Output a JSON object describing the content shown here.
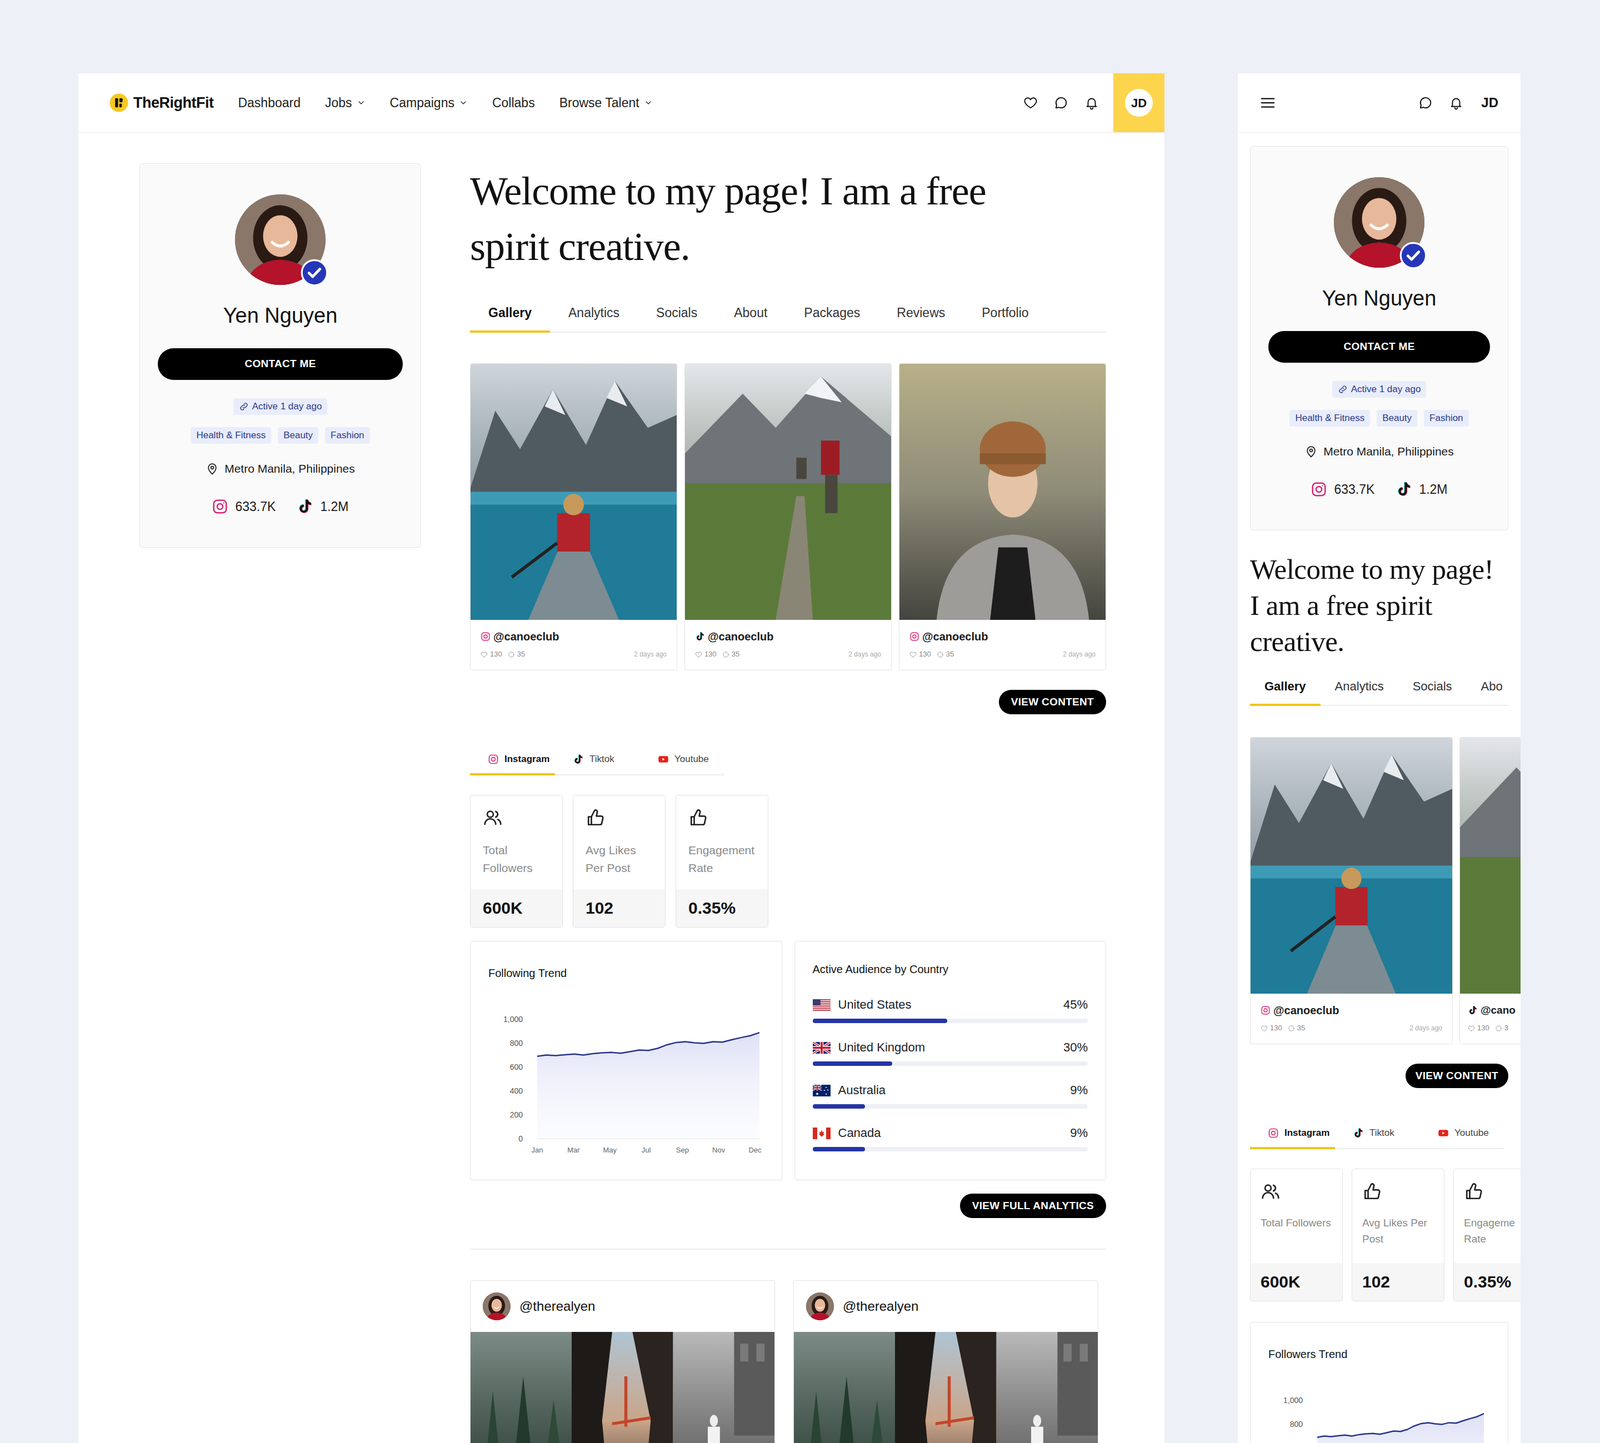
{
  "brand": {
    "name": "TheRightFit"
  },
  "nav": [
    {
      "label": "Dashboard",
      "dropdown": false
    },
    {
      "label": "Jobs",
      "dropdown": true
    },
    {
      "label": "Campaigns",
      "dropdown": true
    },
    {
      "label": "Collabs",
      "dropdown": false
    },
    {
      "label": "Browse Talent",
      "dropdown": true
    }
  ],
  "user": {
    "initials": "JD"
  },
  "profile": {
    "name": "Yen Nguyen",
    "verified": true,
    "contact_button": "CONTACT ME",
    "active": "Active 1 day ago",
    "tags": [
      "Health & Fitness",
      "Beauty",
      "Fashion"
    ],
    "location": "Metro Manila, Philippines",
    "followers": [
      {
        "platform": "instagram",
        "count": "633.7K"
      },
      {
        "platform": "tiktok",
        "count": "1.2M"
      }
    ]
  },
  "headline": "Welcome to my page! I am a free spirit creative.",
  "tabs": [
    {
      "label": "Gallery",
      "selected": true
    },
    {
      "label": "Analytics",
      "selected": false
    },
    {
      "label": "Socials",
      "selected": false
    },
    {
      "label": "About",
      "selected": false
    },
    {
      "label": "Packages",
      "selected": false
    },
    {
      "label": "Reviews",
      "selected": false
    },
    {
      "label": "Portfolio",
      "selected": false
    }
  ],
  "gallery": [
    {
      "platform": "instagram",
      "handle": "@canoeclub",
      "likes": "130",
      "comments": "35",
      "time": "2 days ago"
    },
    {
      "platform": "tiktok",
      "handle": "@canoeclub",
      "likes": "130",
      "comments": "35",
      "time": "2 days ago"
    },
    {
      "platform": "instagram",
      "handle": "@canoeclub",
      "likes": "130",
      "comments": "35",
      "time": "2 days ago"
    }
  ],
  "view_content": "VIEW CONTENT",
  "platform_tabs": [
    {
      "platform": "instagram",
      "label": "Instagram",
      "selected": true
    },
    {
      "platform": "tiktok",
      "label": "Tiktok",
      "selected": false
    },
    {
      "platform": "youtube",
      "label": "Youtube",
      "selected": false
    }
  ],
  "metrics": [
    {
      "kind": "followers",
      "label": "Total Followers",
      "value": "600K"
    },
    {
      "kind": "likes",
      "label": "Avg Likes Per Post",
      "value": "102"
    },
    {
      "kind": "likes",
      "label": "Engagement Rate",
      "value": "0.35%"
    }
  ],
  "trend": {
    "title": "Following Trend",
    "y_ticks": [
      "1,000",
      "800",
      "600",
      "400",
      "200",
      "0"
    ],
    "x_ticks": [
      "Jan",
      "Mar",
      "May",
      "Jul",
      "Sep",
      "Nov",
      "Dec"
    ],
    "values": [
      690,
      700,
      696,
      702,
      708,
      700,
      712,
      718,
      722,
      715,
      728,
      742,
      738,
      756,
      785,
      805,
      812,
      802,
      798,
      812,
      808,
      828,
      846,
      862,
      888
    ]
  },
  "audience": {
    "title": "Active Audience by Country",
    "rows": [
      {
        "flag": "us",
        "country": "United States",
        "share": "45%",
        "level": 0.49
      },
      {
        "flag": "uk",
        "country": "United Kingdom",
        "share": "30%",
        "level": 0.29
      },
      {
        "flag": "au",
        "country": "Australia",
        "share": "9%",
        "level": 0.19
      },
      {
        "flag": "ca",
        "country": "Canada",
        "share": "9%",
        "level": 0.19
      }
    ]
  },
  "view_analytics": "VIEW FULL ANALYTICS",
  "posts": [
    {
      "handle": "@therealyen"
    },
    {
      "handle": "@therealyen"
    }
  ],
  "mobile": {
    "tabs": [
      {
        "label": "Gallery",
        "selected": true
      },
      {
        "label": "Analytics",
        "selected": false
      },
      {
        "label": "Socials",
        "selected": false
      },
      {
        "label": "Abo",
        "selected": false
      }
    ],
    "gallery_partial": {
      "platform": "tiktok",
      "handle": "@cano",
      "likes": "130",
      "comments": "3"
    },
    "metric_partial": {
      "kind": "likes",
      "label": "Engageme Rate",
      "value": "0.35%"
    },
    "trend": {
      "title": "Followers Trend",
      "y_ticks": [
        "1,000",
        "800"
      ]
    }
  }
}
